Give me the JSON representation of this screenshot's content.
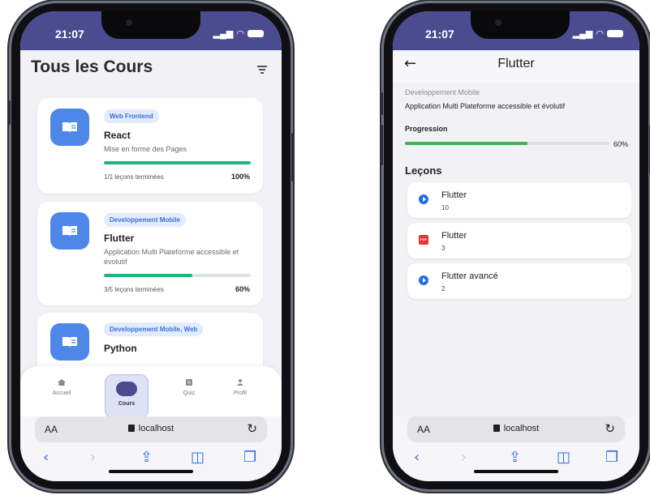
{
  "left": {
    "status_time": "21:07",
    "title": "Tous les Cours",
    "courses": [
      {
        "tag": "Web Frontend",
        "name": "React",
        "desc": "Mise en forme des Pages",
        "count": "1/1 leçons terminées",
        "pct": "100%",
        "progress": 1.0
      },
      {
        "tag": "Developpement Mobile",
        "name": "Flutter",
        "desc": "Application Multi Plateforme accessible et évolutif",
        "count": "3/5 leçons terminées",
        "pct": "60%",
        "progress": 0.6
      },
      {
        "tag": "Developpement Mobile, Web",
        "name": "Python"
      }
    ],
    "nav": [
      {
        "label": "Accueil",
        "icon": "home-icon"
      },
      {
        "label": "Cours",
        "icon": "book-icon",
        "active": true
      },
      {
        "label": "Quiz",
        "icon": "quiz-icon"
      },
      {
        "label": "Profil",
        "icon": "person-icon"
      }
    ],
    "browser": {
      "aa": "AA",
      "url": "localhost"
    }
  },
  "right": {
    "status_time": "21:07",
    "title": "Flutter",
    "category": "Developpement Mobile",
    "description": "Application Multi Plateforme accessible et évolutif",
    "progress_label": "Progression",
    "progress_pct": "60%",
    "progress": 0.6,
    "lessons_title": "Leçons",
    "lessons": [
      {
        "name": "Flutter",
        "count": "10",
        "icon": "play-icon"
      },
      {
        "name": "Flutter",
        "count": "3",
        "icon": "pdf-icon"
      },
      {
        "name": "Flutter avancé",
        "count": "2",
        "icon": "play-icon"
      }
    ],
    "browser": {
      "aa": "AA",
      "url": "localhost"
    }
  },
  "colors": {
    "status_bar": "#4b4c8f",
    "course_icon": "#4f87e8",
    "progress_green": "#22b37d",
    "safari_blue": "#2d6fe8"
  }
}
